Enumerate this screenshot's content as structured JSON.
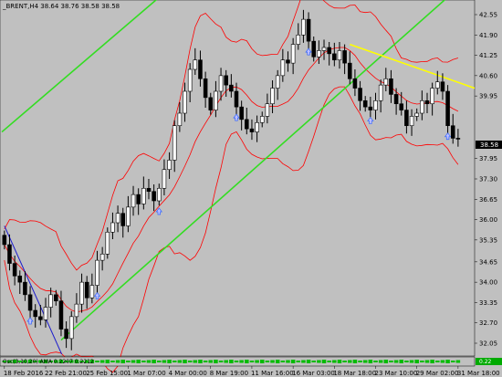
{
  "header": {
    "symbol_line": "_BRENT,H4  38.64 38.76 38.58 38.58"
  },
  "indicator": {
    "label": "Osc(3,10,20) AMA 0.2207 0.2212",
    "value": "0.22"
  },
  "current_price": "38.58",
  "colors": {
    "background": "#c0c0c0",
    "bull_candle": "#000000",
    "bear_candle": "#000000",
    "bb_band": "#ff0000",
    "trend_green": "#33dd22",
    "trend_yellow": "#ffff00",
    "trend_blue": "#1a1acc",
    "arrow": "#3366ff",
    "indicator_fill": "#00bb00"
  },
  "chart_data": {
    "type": "candlestick",
    "title": "_BRENT,H4",
    "ylim": [
      31.7,
      42.9
    ],
    "y_ticks": [
      "42.55",
      "41.90",
      "41.25",
      "40.60",
      "39.95",
      "38.58",
      "37.95",
      "37.30",
      "36.65",
      "36.00",
      "35.35",
      "34.65",
      "34.00",
      "33.35",
      "32.70",
      "32.05"
    ],
    "y_tick_values": [
      42.55,
      41.9,
      41.25,
      40.6,
      39.95,
      38.58,
      37.95,
      37.3,
      36.65,
      36.0,
      35.35,
      34.65,
      34.0,
      33.35,
      32.7,
      32.05
    ],
    "x_ticks": [
      "18 Feb 2016",
      "22 Feb 21:00",
      "25 Feb 15:00",
      "1 Mar 07:00",
      "4 Mar 00:00",
      "8 Mar 19:00",
      "11 Mar 16:00",
      "16 Mar 03:00",
      "18 Mar 18:00",
      "23 Mar 10:00",
      "29 Mar 02:00",
      "31 Mar 18:00"
    ],
    "x_tick_index": [
      0,
      8,
      16,
      24,
      32,
      40,
      48,
      56,
      64,
      72,
      80,
      88
    ],
    "closes": [
      35.2,
      34.6,
      34.2,
      34.0,
      33.6,
      33.1,
      32.9,
      32.8,
      33.2,
      33.6,
      33.4,
      32.5,
      32.2,
      32.9,
      33.3,
      34.0,
      33.5,
      33.9,
      34.7,
      34.9,
      35.6,
      35.9,
      36.2,
      35.8,
      36.4,
      36.8,
      36.5,
      37.0,
      36.9,
      36.6,
      37.0,
      37.6,
      37.9,
      39.0,
      39.4,
      40.1,
      40.8,
      41.1,
      40.5,
      39.9,
      39.5,
      40.1,
      40.6,
      40.3,
      40.1,
      39.6,
      39.2,
      38.9,
      38.8,
      39.1,
      39.3,
      39.7,
      40.2,
      40.6,
      41.1,
      41.0,
      41.6,
      41.9,
      42.4,
      41.7,
      41.2,
      41.4,
      41.5,
      41.3,
      41.1,
      41.4,
      41.0,
      40.5,
      40.2,
      39.8,
      39.6,
      39.5,
      39.8,
      40.3,
      40.5,
      40.0,
      39.7,
      39.5,
      39.0,
      39.3,
      39.4,
      39.8,
      39.7,
      40.2,
      40.4,
      40.1,
      39.0,
      38.6,
      38.58
    ]
  }
}
